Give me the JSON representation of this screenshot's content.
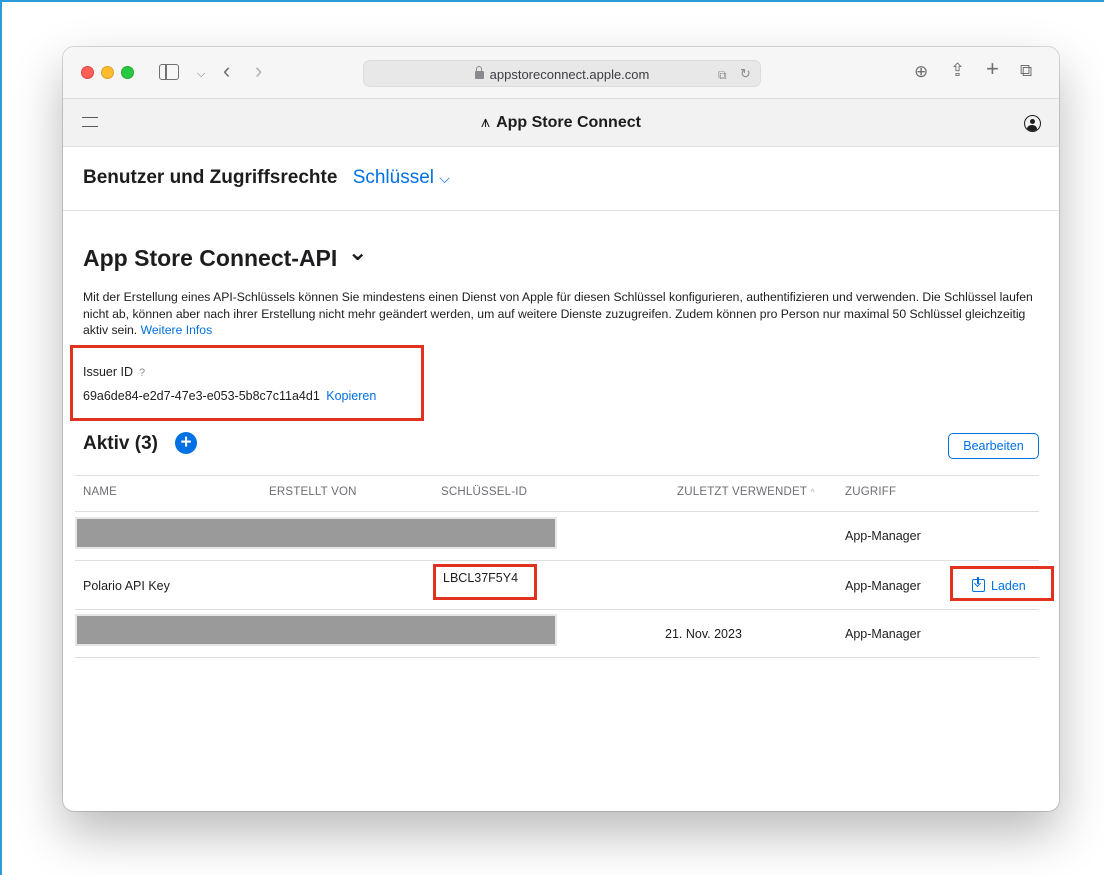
{
  "browser": {
    "url": "appstoreconnect.apple.com",
    "icons": [
      "sidebar-icon",
      "chevron-down-icon",
      "back-icon",
      "forward-icon",
      "lock-icon",
      "translate-icon",
      "reload-icon",
      "download-icon",
      "share-icon",
      "new-tab-icon",
      "tabs-overview-icon"
    ]
  },
  "app": {
    "title": "App Store Connect",
    "logo_glyph": "⩚"
  },
  "breadcrumb": {
    "main": "Benutzer und Zugriffsrechte",
    "sub": "Schlüssel",
    "sub_chevron": "⌵"
  },
  "section": {
    "title": "App Store Connect-API",
    "title_chevron": "⌄",
    "description": "Mit der Erstellung eines API-Schlüssels können Sie mindestens einen Dienst von Apple für diesen Schlüssel konfigurieren, authentifizieren und verwenden. Die Schlüssel laufen nicht ab, können aber nach ihrer Erstellung nicht mehr geändert werden, um auf weitere Dienste zuzugreifen. Zudem können pro Person nur maximal 50 Schlüssel gleichzeitig aktiv sein.",
    "more_link": "Weitere Infos"
  },
  "issuer": {
    "label": "Issuer ID",
    "help": "?",
    "value": "69a6de84-e2d7-47e3-e053-5b8c7c11a4d1",
    "copy_label": "Kopieren"
  },
  "active": {
    "title": "Aktiv (3)",
    "add_glyph": "+",
    "edit_label": "Bearbeiten"
  },
  "table": {
    "headers": {
      "name": "NAME",
      "created_by": "ERSTELLT VON",
      "key_id": "SCHLÜSSEL-ID",
      "last_used": "ZULETZT VERWENDET",
      "last_used_sort": "^",
      "access": "ZUGRIFF"
    },
    "rows": [
      {
        "name": "",
        "created_by": "",
        "key_id": "",
        "last_used": "",
        "access": "App-Manager",
        "redacted": true
      },
      {
        "name": "Polario API Key",
        "created_by": "",
        "key_id": "LBCL37F5Y4",
        "last_used": "",
        "access": "App-Manager",
        "download_label": "Laden",
        "redacted": false
      },
      {
        "name": "",
        "created_by": "",
        "key_id": "",
        "last_used": "21. Nov. 2023",
        "access": "App-Manager",
        "redacted": true
      }
    ]
  },
  "colors": {
    "accent": "#0071e3",
    "highlight": "#e0321e",
    "redaction": "#9a9a9a"
  }
}
